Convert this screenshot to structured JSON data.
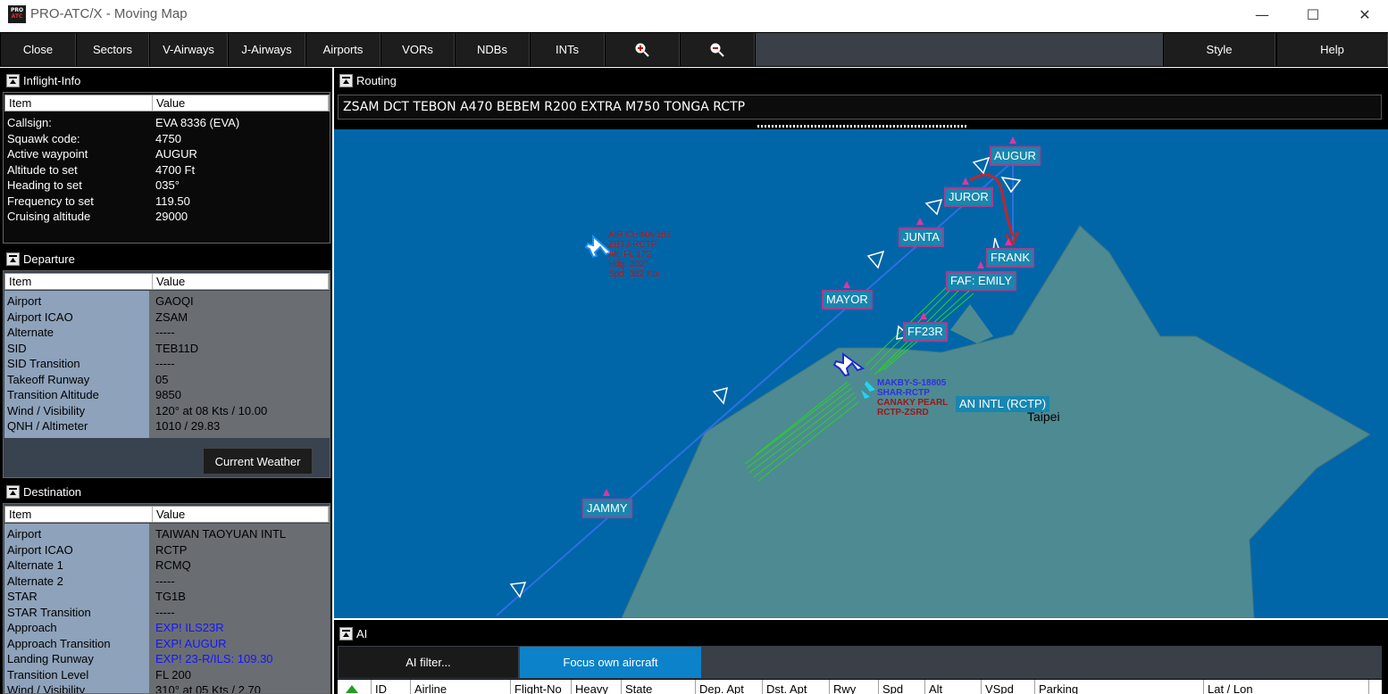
{
  "window": {
    "title": "PRO-ATC/X - Moving Map",
    "logo_line1": "PRO",
    "logo_line2": "ATC"
  },
  "window_controls": {
    "minimize": "—",
    "maximize": "☐",
    "close": "✕"
  },
  "menu": {
    "close": "Close",
    "sectors": "Sectors",
    "v_airways": "V-Airways",
    "j_airways": "J-Airways",
    "airports": "Airports",
    "vors": "VORs",
    "ndbs": "NDBs",
    "ints": "INTs",
    "zoom_in_icon": "zoom-in-icon",
    "zoom_out_icon": "zoom-out-icon",
    "style": "Style",
    "help": "Help"
  },
  "inflight": {
    "title": "Inflight-Info",
    "col_item": "Item",
    "col_value": "Value",
    "rows": [
      {
        "k": "Callsign:",
        "v": "EVA 8336 (EVA)"
      },
      {
        "k": "Squawk code:",
        "v": "4750"
      },
      {
        "k": "Active waypoint",
        "v": "AUGUR"
      },
      {
        "k": "Altitude to set",
        "v": "4700 Ft"
      },
      {
        "k": "Heading to set",
        "v": "035°"
      },
      {
        "k": "Frequency to set",
        "v": "119.50"
      },
      {
        "k": "Cruising altitude",
        "v": "29000"
      }
    ]
  },
  "departure": {
    "title": "Departure",
    "col_item": "Item",
    "col_value": "Value",
    "rows": [
      {
        "k": "Airport",
        "v": "GAOQI"
      },
      {
        "k": "Airport ICAO",
        "v": "ZSAM"
      },
      {
        "k": "Alternate",
        "v": "-----"
      },
      {
        "k": "SID",
        "v": "TEB11D"
      },
      {
        "k": "SID Transition",
        "v": "-----"
      },
      {
        "k": "Takeoff Runway",
        "v": "05"
      },
      {
        "k": "Transition Altitude",
        "v": "9850"
      },
      {
        "k": "Wind / Visibility",
        "v": "120° at 08 Kts / 10.00"
      },
      {
        "k": "QNH / Altimeter",
        "v": "1010 / 29.83"
      }
    ],
    "weather_button": "Current Weather"
  },
  "destination": {
    "title": "Destination",
    "col_item": "Item",
    "col_value": "Value",
    "rows": [
      {
        "k": "Airport",
        "v": "TAIWAN TAOYUAN INTL"
      },
      {
        "k": "Airport ICAO",
        "v": "RCTP"
      },
      {
        "k": "Alternate 1",
        "v": "RCMQ"
      },
      {
        "k": "Alternate 2",
        "v": "-----"
      },
      {
        "k": "STAR",
        "v": "TG1B"
      },
      {
        "k": "STAR Transition",
        "v": "-----"
      },
      {
        "k": "Approach",
        "v": "EXP! ILS23R"
      },
      {
        "k": "Approach Transition",
        "v": "EXP! AUGUR"
      },
      {
        "k": "Landing Runway",
        "v": "EXP! 23-R/ILS: 109.30"
      },
      {
        "k": "Transition Level",
        "v": "FL 200"
      },
      {
        "k": "Wind / Visibility",
        "v": "310° at 05 Kts / 2.70"
      }
    ]
  },
  "routing": {
    "title": "Routing",
    "route": "ZSAM DCT TEBON A470 BEBEM R200 EXTRA M750 TONGA RCTP"
  },
  "map": {
    "waypoints": [
      "AUGUR",
      "JUROR",
      "JUNTA",
      "FRANK",
      "FAF: EMILY",
      "MAYOR",
      "FF23R",
      "JAMMY"
    ],
    "airport_label": "AN INTL (RCTP)",
    "city_label": "Taipei",
    "traffic": {
      "callsign": "AIR CHINA-187",
      "route": "ZBTJ-RCTP",
      "alt": "Alt: FL 172",
      "hdg": "Hdg: 202°",
      "spd": "Spd: 382 Kts"
    },
    "ground_labels": [
      "MAKBY-S-18805",
      "SHAR-RCTP",
      "CANAKY PEARL",
      "RCTP-ZSRD"
    ],
    "colors": {
      "sea": "#0066a8",
      "land": "#4e8a92",
      "route": "#2f6fe0",
      "waypoint_box": "#1787b0",
      "waypoint_border": "#a04090",
      "traffic_label": "#c01515",
      "approach": "#2ad12a"
    }
  },
  "ai": {
    "title": "AI",
    "filter_button": "AI filter...",
    "focus_button": "Focus own aircraft",
    "columns": [
      "ID",
      "Airline",
      "Flight-No",
      "Heavy",
      "State",
      "Dep. Apt",
      "Dst. Apt",
      "Rwy",
      "Spd",
      "Alt",
      "VSpd",
      "Parking",
      "Lat / Lon"
    ]
  }
}
